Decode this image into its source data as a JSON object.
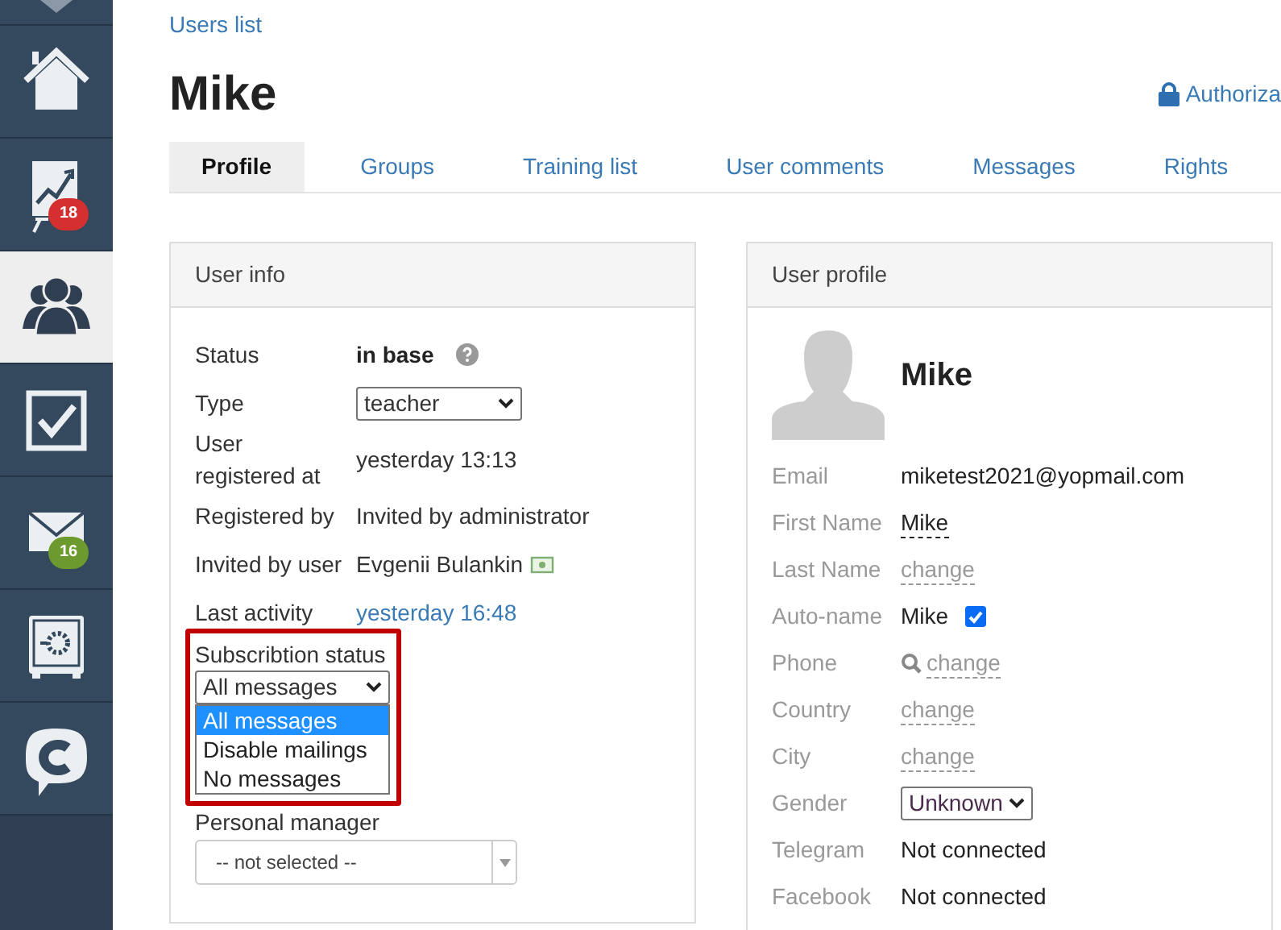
{
  "sidebar": {
    "items": [
      {
        "kind": "top",
        "selected": false
      },
      {
        "kind": "home",
        "selected": false
      },
      {
        "kind": "chart",
        "selected": false,
        "badge": "18",
        "color": "#d3302f"
      },
      {
        "kind": "users",
        "selected": true
      },
      {
        "kind": "tasks",
        "selected": false
      },
      {
        "kind": "mail",
        "selected": false,
        "badge": "16",
        "color": "#6d9a2e"
      },
      {
        "kind": "safe",
        "selected": false
      },
      {
        "kind": "chat",
        "selected": false
      }
    ]
  },
  "breadcrumb": "Users list",
  "title": "Mike",
  "authorization_link": "Authoriza",
  "tabs": [
    {
      "label": "Profile",
      "selected": true
    },
    {
      "label": "Groups",
      "selected": false
    },
    {
      "label": "Training list",
      "selected": false
    },
    {
      "label": "User comments",
      "selected": false
    },
    {
      "label": "Messages",
      "selected": false
    },
    {
      "label": "Rights",
      "selected": false
    }
  ],
  "user_info": {
    "title": "User info",
    "rows": [
      {
        "label": "Status",
        "kind": "bold_help",
        "value": "in base"
      },
      {
        "label": "Type",
        "kind": "select",
        "value": "teacher"
      },
      {
        "label": "User registered at",
        "kind": "text",
        "value": "yesterday 13:13"
      },
      {
        "label": "Registered by",
        "kind": "text",
        "value": "Invited by administrator"
      },
      {
        "label": "Invited by user",
        "kind": "text_icon",
        "value": "Evgenii Bulankin"
      },
      {
        "label": "Last activity",
        "kind": "link",
        "value": "yesterday 16:48"
      }
    ],
    "subscription": {
      "label": "Subscribtion status",
      "value": "All messages",
      "expanded": true,
      "options": [
        {
          "label": "All messages",
          "selected": true
        },
        {
          "label": "Disable mailings",
          "selected": false
        },
        {
          "label": "No messages",
          "selected": false
        }
      ]
    },
    "personal_manager": {
      "label": "Personal manager",
      "value": "-- not selected --"
    }
  },
  "user_profile": {
    "title": "User profile",
    "name": "Mike",
    "rows": [
      {
        "label": "Email",
        "kind": "text",
        "value": "miketest2021@yopmail.com"
      },
      {
        "label": "First Name",
        "kind": "editable",
        "value": "Mike"
      },
      {
        "label": "Last Name",
        "kind": "change",
        "value": "change"
      },
      {
        "label": "Auto-name",
        "kind": "checkbox",
        "value": "Mike",
        "checked": true
      },
      {
        "label": "Phone",
        "kind": "search_change",
        "value": "change"
      },
      {
        "label": "Country",
        "kind": "change",
        "value": "change"
      },
      {
        "label": "City",
        "kind": "change",
        "value": "change"
      },
      {
        "label": "Gender",
        "kind": "select",
        "value": "Unknown"
      },
      {
        "label": "Telegram",
        "kind": "text",
        "value": "Not connected"
      },
      {
        "label": "Facebook",
        "kind": "text",
        "value": "Not connected"
      }
    ]
  }
}
